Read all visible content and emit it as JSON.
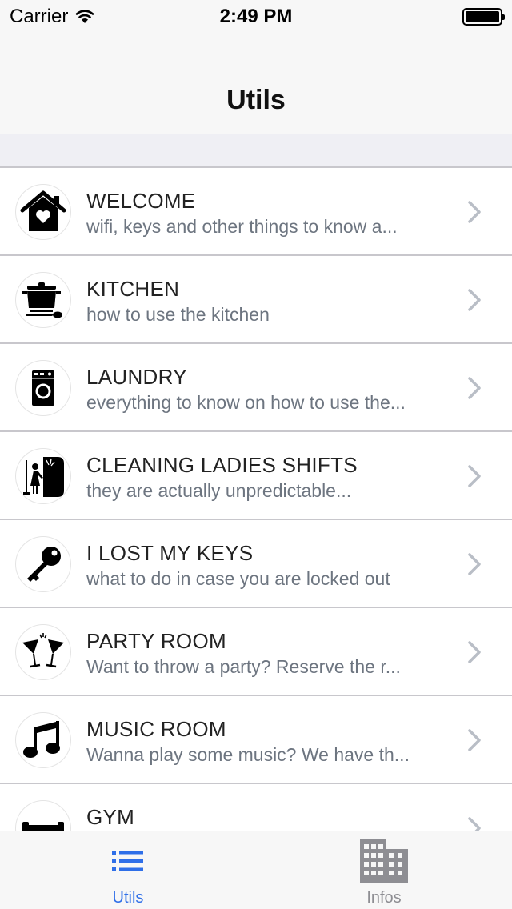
{
  "status_bar": {
    "carrier": "Carrier",
    "time": "2:49 PM"
  },
  "nav": {
    "title": "Utils"
  },
  "rows": [
    {
      "title": "WELCOME",
      "subtitle": "wifi, keys and other things to know a...",
      "icon": "house-heart-icon"
    },
    {
      "title": "KITCHEN",
      "subtitle": "how to use the kitchen",
      "icon": "cooking-pot-icon"
    },
    {
      "title": "LAUNDRY",
      "subtitle": "everything to know on how to use the...",
      "icon": "washing-machine-icon"
    },
    {
      "title": "CLEANING LADIES SHIFTS",
      "subtitle": "they are actually unpredictable...",
      "icon": "cleaning-lady-icon"
    },
    {
      "title": "I LOST MY KEYS",
      "subtitle": "what to do in case you are locked out",
      "icon": "key-icon"
    },
    {
      "title": "PARTY ROOM",
      "subtitle": "Want to throw a party? Reserve the r...",
      "icon": "cocktail-glasses-icon"
    },
    {
      "title": "MUSIC ROOM",
      "subtitle": "Wanna play some music? We have th...",
      "icon": "music-note-icon"
    },
    {
      "title": "GYM",
      "subtitle": "",
      "icon": "dumbbell-icon"
    }
  ],
  "tabs": [
    {
      "label": "Utils",
      "icon": "list-icon",
      "active": true
    },
    {
      "label": "Infos",
      "icon": "building-icon",
      "active": false
    }
  ],
  "colors": {
    "accent": "#2f6fe8",
    "inactive": "#8e8e93",
    "subtitle": "#6d7580",
    "separator": "#c8c7cc"
  }
}
